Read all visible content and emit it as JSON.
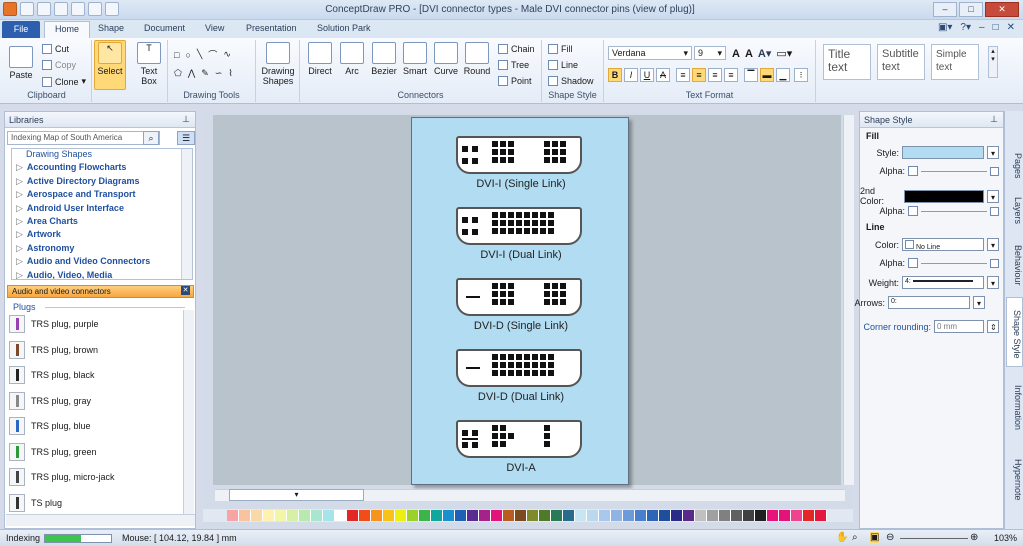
{
  "window": {
    "title": "ConceptDraw PRO - [DVI connector types - Male DVI connector pins (view of plug)]"
  },
  "tabs": [
    "File",
    "Home",
    "Shape",
    "Document",
    "View",
    "Presentation",
    "Solution Park"
  ],
  "ribbon": {
    "clipboard": {
      "label": "Clipboard",
      "paste": "Paste",
      "cut": "Cut",
      "copy": "Copy",
      "clone": "Clone"
    },
    "select": {
      "label": "Select"
    },
    "textbox": {
      "label": "Text Box"
    },
    "drawing_tools": {
      "label": "Drawing Tools"
    },
    "drawing_shapes": {
      "label": "Drawing Shapes"
    },
    "connectors": {
      "label": "Connectors",
      "items": [
        "Direct",
        "Arc",
        "Bezier",
        "Smart",
        "Curve",
        "Round"
      ],
      "chain": "Chain",
      "tree": "Tree",
      "point": "Point"
    },
    "shape_style": {
      "label": "Shape Style",
      "fill": "Fill",
      "line": "Line",
      "shadow": "Shadow"
    },
    "text_format": {
      "label": "Text Format",
      "font": "Verdana",
      "size": "9",
      "bold": "B",
      "italic": "I",
      "underline": "U",
      "strike": "A"
    },
    "styles": {
      "title": "Title text",
      "subtitle": "Subtitle text",
      "simple": "Simple text"
    }
  },
  "libraries": {
    "title": "Libraries",
    "search_placeholder": "Indexing Map of South America",
    "items": [
      "Drawing Shapes",
      "Accounting Flowcharts",
      "Active Directory Diagrams",
      "Aerospace and Transport",
      "Android User Interface",
      "Area Charts",
      "Artwork",
      "Astronomy",
      "Audio and Video Connectors",
      "Audio, Video, Media"
    ],
    "selected_library": "Audio and video connectors",
    "section": "Plugs",
    "plugs": [
      {
        "name": "TRS plug, purple",
        "color": "#9a3fb0"
      },
      {
        "name": "TRS plug, brown",
        "color": "#7a4a2a"
      },
      {
        "name": "TRS plug, black",
        "color": "#222222"
      },
      {
        "name": "TRS plug, gray",
        "color": "#888888"
      },
      {
        "name": "TRS plug, blue",
        "color": "#2a66c4"
      },
      {
        "name": "TRS plug, green",
        "color": "#2d9a3a"
      },
      {
        "name": "TRS plug, micro-jack",
        "color": "#444444"
      },
      {
        "name": "TS plug",
        "color": "#333333"
      }
    ]
  },
  "diagram": {
    "connectors": [
      {
        "label": "DVI-I (Single Link)",
        "type": "single",
        "analog": true
      },
      {
        "label": "DVI-I (Dual Link)",
        "type": "dual",
        "analog": true
      },
      {
        "label": "DVI-D (Single Link)",
        "type": "single",
        "analog": false
      },
      {
        "label": "DVI-D (Dual Link)",
        "type": "dual",
        "analog": false
      },
      {
        "label": "DVI-A",
        "type": "a",
        "analog": true
      }
    ]
  },
  "shape_style": {
    "title": "Shape Style",
    "fill_label": "Fill",
    "style_label": "Style:",
    "alpha_label": "Alpha:",
    "second_color_label": "2nd Color:",
    "line_label": "Line",
    "color_label": "Color:",
    "color_value": "No Line",
    "weight_label": "Weight:",
    "weight_value": "4:",
    "arrows_label": "Arrows:",
    "arrows_value": "0:",
    "corner_label": "Corner rounding:",
    "corner_value": "0 mm",
    "fill_color": "#b2dcf1",
    "second_color": "#000000"
  },
  "side_tabs": [
    "Pages",
    "Layers",
    "Behaviour",
    "Shape Style",
    "Information",
    "Hypernote"
  ],
  "palette": [
    "#f7a4a4",
    "#f9c3a0",
    "#fad9a8",
    "#fff2b0",
    "#f2f7a8",
    "#d7f0a6",
    "#b9e8b0",
    "#a9e6cf",
    "#a7e4ea",
    "#ffffff",
    "#e32626",
    "#f04d1b",
    "#f7941d",
    "#f8c21a",
    "#ecf010",
    "#9bd12a",
    "#3bb54a",
    "#12a79d",
    "#1a8fd0",
    "#1f5fb5",
    "#5a2c91",
    "#a5228a",
    "#e3137b",
    "#b85c1f",
    "#7b4b1f",
    "#7f8a2a",
    "#4f7a2a",
    "#2a7a5a",
    "#2a6a8a",
    "#c8e6f2",
    "#bcd8ef",
    "#a9c8ec",
    "#8fb4e4",
    "#6d9ad8",
    "#4a7fcb",
    "#2f65b7",
    "#1d4f9c",
    "#2a2a8a",
    "#5a2a8a",
    "#c0c0c0",
    "#a0a0a0",
    "#808080",
    "#606060",
    "#404040",
    "#202020",
    "#e7157b",
    "#e3137b",
    "#f0438f",
    "#e32626",
    "#e4183f"
  ],
  "status": {
    "indexing": "Indexing",
    "indexing_progress": 0.55,
    "mouse": "Mouse: [ 104.12, 19.84 ] mm",
    "zoom": "103%"
  }
}
